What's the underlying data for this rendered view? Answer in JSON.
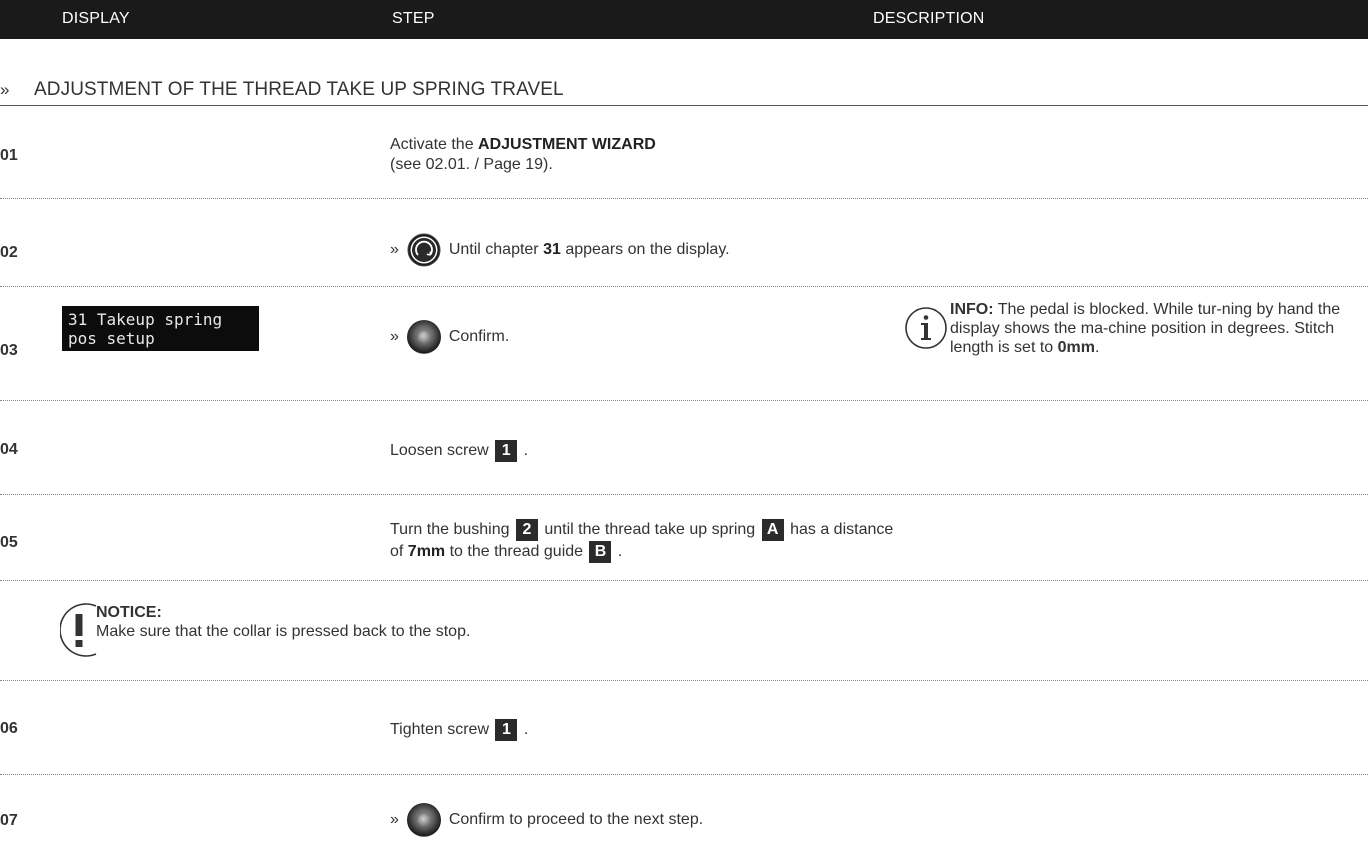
{
  "header": {
    "display": "DISPLAY",
    "step": "STEP",
    "description": "DESCRIPTION"
  },
  "section": {
    "chevron": "»",
    "title": "ADJUSTMENT OF THE THREAD TAKE UP SPRING TRAVEL"
  },
  "rows": {
    "r01": {
      "num": "01",
      "line1_pre": "Activate the ",
      "line1_bold": "ADJUSTMENT WIZARD",
      "line2": "(see 02.01. / Page 19)."
    },
    "r02": {
      "num": "02",
      "prefix": "»",
      "pre": "Until chapter ",
      "bold": "31",
      "post": " appears on the display."
    },
    "r03": {
      "num": "03",
      "lcd_line1": "31 Takeup spring",
      "lcd_line2": "pos setup",
      "prefix": "»",
      "text": "Confirm.",
      "info_label": "INFO:",
      "info_text": " The pedal is blocked. While tur-ning by hand the display shows the ma-chine position in degrees. Stitch length is set to ",
      "info_bold": "0mm",
      "info_end": "."
    },
    "r04": {
      "num": "04",
      "pre": "Loosen screw ",
      "tag": "1",
      "post": " ."
    },
    "r05": {
      "num": "05",
      "pre": "Turn the bushing ",
      "tag1": "2",
      "mid1": " until the thread take up spring ",
      "tag2": "A",
      "mid2": "  has a distance",
      "line2_pre": "of ",
      "line2_bold": "7mm",
      "line2_mid": " to the thread guide ",
      "tag3": "B",
      "line2_post": " ."
    },
    "notice": {
      "label": "NOTICE:",
      "text": "Make sure that the collar is pressed back to the stop."
    },
    "r06": {
      "num": "06",
      "pre": "Tighten screw ",
      "tag": "1",
      "post": " ."
    },
    "r07": {
      "num": "07",
      "prefix": "»",
      "text": "Confirm to proceed to the next step."
    }
  },
  "icons": {
    "rotate_knob": "rotary-knob-turn-icon",
    "press_knob": "rotary-knob-press-icon",
    "info": "info-icon",
    "notice": "exclamation-icon"
  },
  "colors": {
    "header_bg": "#1a1a1a",
    "tag_bg": "#2b2b2b",
    "lcd_bg": "#0c0c0c"
  }
}
